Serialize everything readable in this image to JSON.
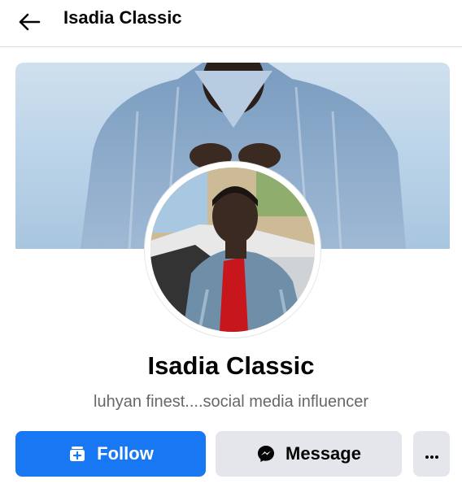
{
  "header": {
    "title": "Isadia Classic",
    "back_icon": "arrow-left-icon"
  },
  "profile": {
    "name": "Isadia Classic",
    "bio": "luhyan finest....social media influencer",
    "cover_photo": "cover-photo",
    "profile_photo": "profile-photo"
  },
  "actions": {
    "follow_label": "Follow",
    "follow_icon": "follow-page-icon",
    "message_label": "Message",
    "message_icon": "messenger-icon",
    "more_icon": "more-horizontal-icon"
  },
  "colors": {
    "primary": "#1877f2",
    "secondary_button": "#e4e6eb",
    "text_primary": "#050505",
    "text_secondary": "#65676b"
  }
}
